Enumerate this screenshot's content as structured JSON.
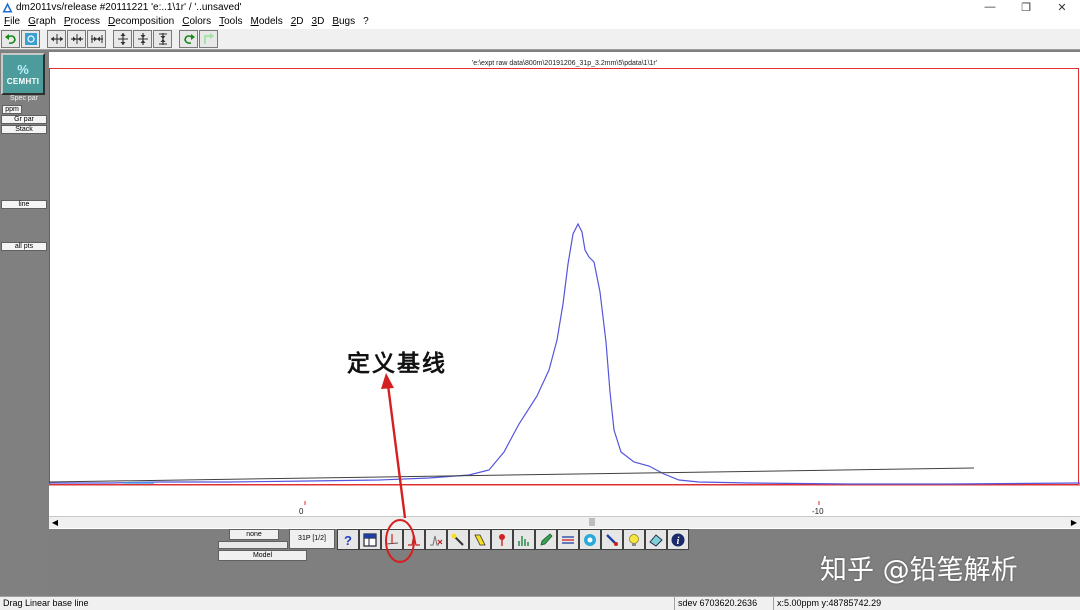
{
  "window": {
    "title": "dm2011vs/release #20111221 'e:..1\\1r' / '..unsaved'",
    "controls": [
      "—",
      "❐",
      "✕"
    ]
  },
  "menu": [
    "File",
    "Graph",
    "Process",
    "Decomposition",
    "Colors",
    "Tools",
    "Models",
    "2D",
    "3D",
    "Bugs",
    "?"
  ],
  "toolbar_icons": [
    "undo-icon",
    "spectrum-settings-icon",
    "expand-horizontal-icon",
    "fit-horizontal-icon",
    "shrink-horizontal-icon",
    "expand-vertical-icon",
    "fit-vertical-icon",
    "shrink-vertical-icon",
    "redo-icon",
    "up-icon"
  ],
  "left_panel": {
    "logo": {
      "mark": "%",
      "text": "CEMHTI"
    },
    "buttons": {
      "spec_par": "Spec par",
      "ppm": "ppm",
      "gr_par": "Gr par",
      "stack": "Stack",
      "line": "line",
      "all_pts": "all pts"
    }
  },
  "plot": {
    "file_path": "'e:\\expt raw data\\800m\\20191206_31p_3.2mm\\5\\pdata\\1\\1r'",
    "x_tick_labels": [
      "0",
      "-10"
    ],
    "colors": {
      "frame": "#e03030",
      "spectrum": "#5555dd",
      "baseline": "#404040",
      "axis_line": "#e03030"
    }
  },
  "bottom": {
    "none_label": "none",
    "model_label": "Model",
    "mode_label": "31P [1/2]",
    "tool_icons": [
      "help-icon",
      "table-icon",
      "baseline-icon",
      "peak-icon",
      "peak-remove-icon",
      "wand-icon",
      "highlight-icon",
      "marker-icon",
      "spectrum-bars-icon",
      "pencil-icon",
      "align-icon",
      "gear-flower-icon",
      "link-icon",
      "bulb-icon",
      "eraser-icon",
      "info-icon"
    ]
  },
  "annotation": {
    "text": "定义基线",
    "color": "#d42020"
  },
  "watermark": "知乎 @铅笔解析",
  "status": {
    "message": "Drag Linear base line",
    "sdev": "sdev 6703620.2636",
    "coords": "x:5.00ppm y:48785742.29"
  }
}
